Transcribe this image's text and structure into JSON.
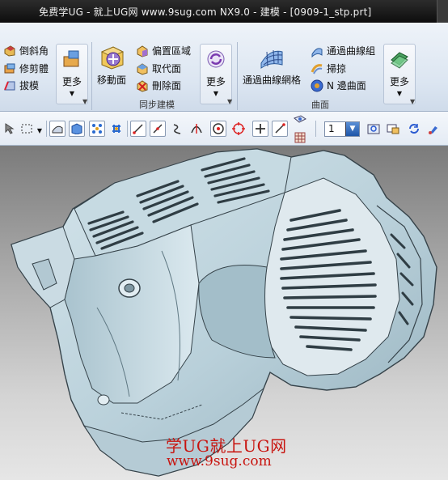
{
  "window": {
    "title": "免费学UG - 就上UG网 www.9sug.com   NX9.0 - 建模 - [0909-1_stp.prt]"
  },
  "ribbon": {
    "feature_group": {
      "items": [
        "倒斜角",
        "修剪體",
        "拔模"
      ],
      "more_label": "更多"
    },
    "sync_group": {
      "move_face_label": "移動面",
      "items": [
        "偏置區域",
        "取代面",
        "刪除面"
      ],
      "more_label": "更多",
      "label": "同步建模"
    },
    "surface_group": {
      "mesh_label": "通過曲線網格",
      "items": [
        "通過曲線組",
        "掃掠",
        "N 邊曲面"
      ],
      "more_label": "更多",
      "label": "曲面"
    }
  },
  "toolbar": {
    "layer_value": "1",
    "icons": [
      "cursor-icon",
      "select-box-icon",
      "shaded-edges-icon",
      "shaded-icon",
      "snap-points-icon",
      "snap-settings-icon",
      "line-icon",
      "tangent-line-icon",
      "curve-icon",
      "intersection-icon",
      "center-point-icon",
      "quadrant-point-icon",
      "plus-point-icon",
      "end-point-icon",
      "view-icon",
      "grid-icon",
      "fit-view-icon",
      "zoom-icon",
      "rotate-icon",
      "brush-icon"
    ]
  },
  "viewport": {
    "watermark_line1": "学UG就上UG网",
    "watermark_line2": "www.9sug.com"
  },
  "colors": {
    "part_fill": "#c2d6df",
    "part_edge": "#36434a",
    "watermark": "#c8140f"
  }
}
